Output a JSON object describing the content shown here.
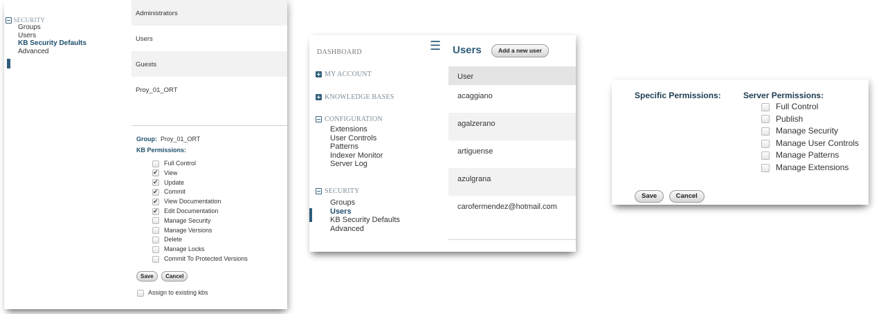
{
  "panel_groups": {
    "nav": {
      "section": "SECURITY",
      "items": [
        "Groups",
        "Users",
        "KB Security Defaults",
        "Advanced"
      ],
      "active": "KB Security Defaults"
    },
    "groups": [
      "Administrators",
      "Users",
      "Guests",
      "Proy_01_ORT"
    ],
    "detail": {
      "group_label": "Group:",
      "group_value": "Proy_01_ORT",
      "permissions_title": "KB Permissions:",
      "permissions": [
        {
          "label": "Full Control",
          "checked": false
        },
        {
          "label": "View",
          "checked": true
        },
        {
          "label": "Update",
          "checked": true
        },
        {
          "label": "Commit",
          "checked": true
        },
        {
          "label": "View Documentation",
          "checked": true
        },
        {
          "label": "Edit Documentation",
          "checked": true
        },
        {
          "label": "Manage Security",
          "checked": false
        },
        {
          "label": "Manage Versions",
          "checked": false
        },
        {
          "label": "Delete",
          "checked": false
        },
        {
          "label": "Manage Locks",
          "checked": false
        },
        {
          "label": "Commit To Protected Versions",
          "checked": false
        }
      ],
      "save_label": "Save",
      "cancel_label": "Cancel",
      "assign_label": "Assign to existing kbs",
      "assign_checked": false
    }
  },
  "panel_users": {
    "nav": {
      "dashboard": "DASHBOARD",
      "my_account": "MY ACCOUNT",
      "knowledge_bases": "KNOWLEDGE BASES",
      "configuration": "CONFIGURATION",
      "configuration_items": [
        "Extensions",
        "User Controls",
        "Patterns",
        "Indexer Monitor",
        "Server Log"
      ],
      "security": "SECURITY",
      "security_items": [
        "Groups",
        "Users",
        "KB Security Defaults",
        "Advanced"
      ],
      "active": "Users"
    },
    "menu_icon": "hamburger-icon",
    "title": "Users",
    "add_button": "Add a new user",
    "table": {
      "header": "User",
      "rows": [
        "acaggiano",
        "agalzerano",
        "artiguense",
        "azulgrana",
        "carofermendez@hotmail.com"
      ]
    }
  },
  "panel_server": {
    "specific_title": "Specific Permissions:",
    "server_title": "Server Permissions:",
    "permissions": [
      {
        "label": "Full Control",
        "checked": false
      },
      {
        "label": "Publish",
        "checked": false
      },
      {
        "label": "Manage Security",
        "checked": false
      },
      {
        "label": "Manage User Controls",
        "checked": false
      },
      {
        "label": "Manage Patterns",
        "checked": false
      },
      {
        "label": "Manage Extensions",
        "checked": false
      }
    ],
    "save_label": "Save",
    "cancel_label": "Cancel"
  },
  "colors": {
    "accent": "#2d5d7b",
    "heading": "#1d4e6c",
    "row_alt": "#f2f2f2",
    "table_header": "#e4e4e4"
  }
}
